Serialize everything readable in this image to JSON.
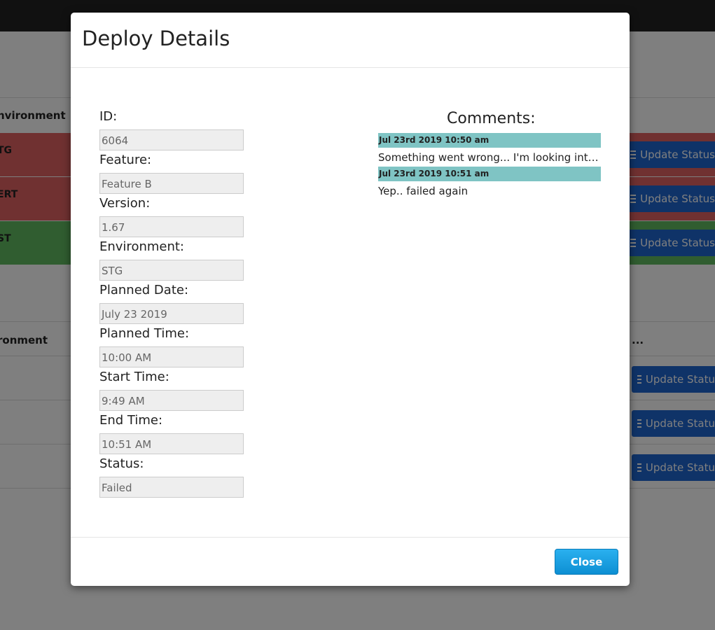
{
  "background": {
    "table1": {
      "header_env": "nvironment",
      "rows": [
        {
          "env": "TG",
          "status_color": "#e06363",
          "action": "Update Status"
        },
        {
          "env": "ERT",
          "status_color": "#e06363",
          "action": "Update Status"
        },
        {
          "env": "ST",
          "status_color": "#60bb60",
          "action": "Update Status"
        }
      ]
    },
    "table2": {
      "header_env": "ronment",
      "header_right": "...",
      "rows": [
        {
          "action": "Update Statu"
        },
        {
          "action": "Update Statu"
        },
        {
          "action": "Update Statu"
        }
      ]
    }
  },
  "modal": {
    "title": "Deploy Details",
    "fields": [
      {
        "label": "ID:",
        "value": "6064"
      },
      {
        "label": "Feature:",
        "value": "Feature B"
      },
      {
        "label": "Version:",
        "value": "1.67"
      },
      {
        "label": "Environment:",
        "value": "STG"
      },
      {
        "label": "Planned Date:",
        "value": "July 23 2019"
      },
      {
        "label": "Planned Time:",
        "value": "10:00 AM"
      },
      {
        "label": "Start Time:",
        "value": "9:49 AM"
      },
      {
        "label": "End Time:",
        "value": "10:51 AM"
      },
      {
        "label": "Status:",
        "value": "Failed"
      }
    ],
    "comments_title": "Comments:",
    "comments": [
      {
        "date": "Jul 23rd 2019 10:50 am",
        "text": "Something went wrong... I'm looking into it..."
      },
      {
        "date": "Jul 23rd 2019 10:51 am",
        "text": "Yep.. failed again"
      }
    ],
    "close_label": "Close"
  },
  "colors": {
    "navbar": "#222222",
    "row_failed": "#e06363",
    "row_success": "#60bb60",
    "update_button": "#1f66d1",
    "comment_header": "#7fc4c4",
    "close_button": "#1ea0e0"
  }
}
